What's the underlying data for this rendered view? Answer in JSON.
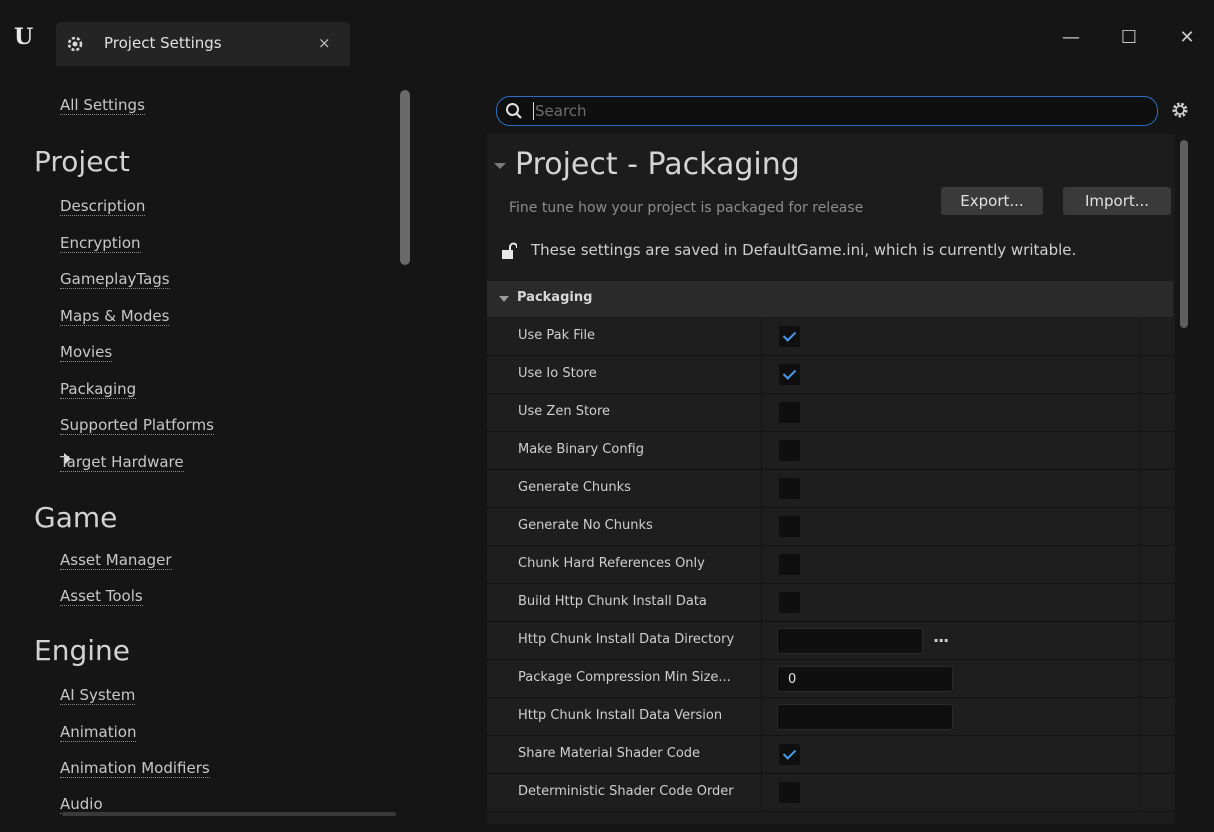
{
  "window": {
    "logo": "U",
    "tab_label": "Project Settings",
    "tab_close": "×",
    "minimize": "—",
    "maximize": "☐",
    "close": "✕"
  },
  "sidebar": {
    "all_settings": "All Settings",
    "sections": [
      {
        "title": "Project",
        "items": [
          "Description",
          "Encryption",
          "GameplayTags",
          "Maps & Modes",
          "Movies",
          "Packaging",
          "Supported Platforms",
          "Target Hardware"
        ]
      },
      {
        "title": "Game",
        "items": [
          "Asset Manager",
          "Asset Tools"
        ]
      },
      {
        "title": "Engine",
        "items": [
          "AI System",
          "Animation",
          "Animation Modifiers",
          "Audio"
        ]
      }
    ],
    "selected": "Packaging"
  },
  "search": {
    "placeholder": "Search",
    "value": ""
  },
  "panel": {
    "title": "Project - Packaging",
    "description": "Fine tune how your project is packaged for release",
    "export_label": "Export...",
    "import_label": "Import...",
    "writable_note": "These settings are saved in DefaultGame.ini, which is currently writable.",
    "section": "Packaging",
    "properties": [
      {
        "name": "Use Pak File",
        "type": "checkbox",
        "checked": true
      },
      {
        "name": "Use Io Store",
        "type": "checkbox",
        "checked": true
      },
      {
        "name": "Use Zen Store",
        "type": "checkbox",
        "checked": false
      },
      {
        "name": "Make Binary Config",
        "type": "checkbox",
        "checked": false
      },
      {
        "name": "Generate Chunks",
        "type": "checkbox",
        "checked": false
      },
      {
        "name": "Generate No Chunks",
        "type": "checkbox",
        "checked": false
      },
      {
        "name": "Chunk Hard References Only",
        "type": "checkbox",
        "checked": false
      },
      {
        "name": "Build Http Chunk Install Data",
        "type": "checkbox",
        "checked": false
      },
      {
        "name": "Http Chunk Install Data Directory",
        "type": "directory",
        "value": "",
        "button": "..."
      },
      {
        "name": "Package Compression Min Size...",
        "type": "text",
        "value": "0"
      },
      {
        "name": "Http Chunk Install Data Version",
        "type": "text",
        "value": ""
      },
      {
        "name": "Share Material Shader Code",
        "type": "checkbox",
        "checked": true
      },
      {
        "name": "Deterministic Shader Code Order",
        "type": "checkbox",
        "checked": false
      }
    ]
  },
  "colors": {
    "accent": "#2e70c4",
    "check": "#4a9bf0",
    "background": "#151515",
    "panel": "#1c1c1c"
  }
}
